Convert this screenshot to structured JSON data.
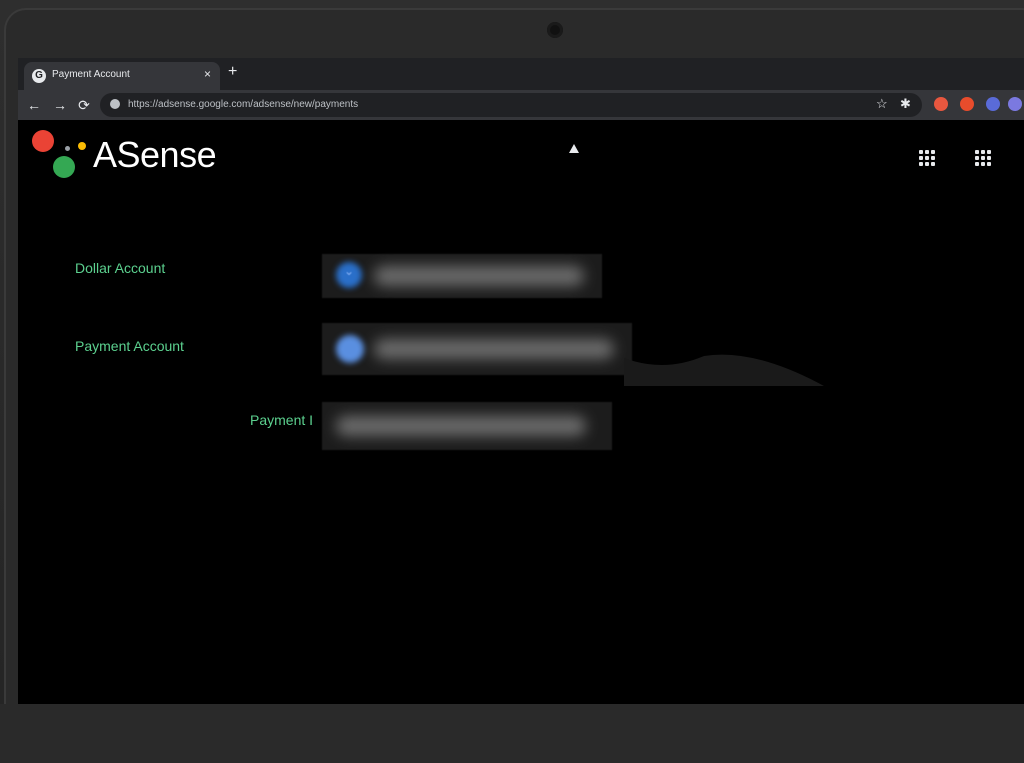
{
  "browser": {
    "tab_title": "Payment Account",
    "tab_close": "×",
    "new_tab": "+",
    "url": "https://adsense.google.com/adsense/new/payments",
    "back": "←",
    "forward": "→",
    "reload": "⟳",
    "star": "☆",
    "ext_icon": "✱",
    "extension_colors": [
      "#e8573f",
      "#e84c2c",
      "#5a6bd8",
      "#7b79e0"
    ]
  },
  "page": {
    "logo_text": "ASense",
    "fields": [
      {
        "label": "Dollar Account",
        "value": ""
      },
      {
        "label": "Payment Account",
        "value": ""
      },
      {
        "label": "Payment I",
        "value": ""
      }
    ],
    "colors": {
      "accent_label": "#5cd18f",
      "dot_red": "#ea4335",
      "dot_green": "#34a853",
      "dot_yellow": "#fbbc04",
      "dot_blue": "#4285f4"
    }
  }
}
